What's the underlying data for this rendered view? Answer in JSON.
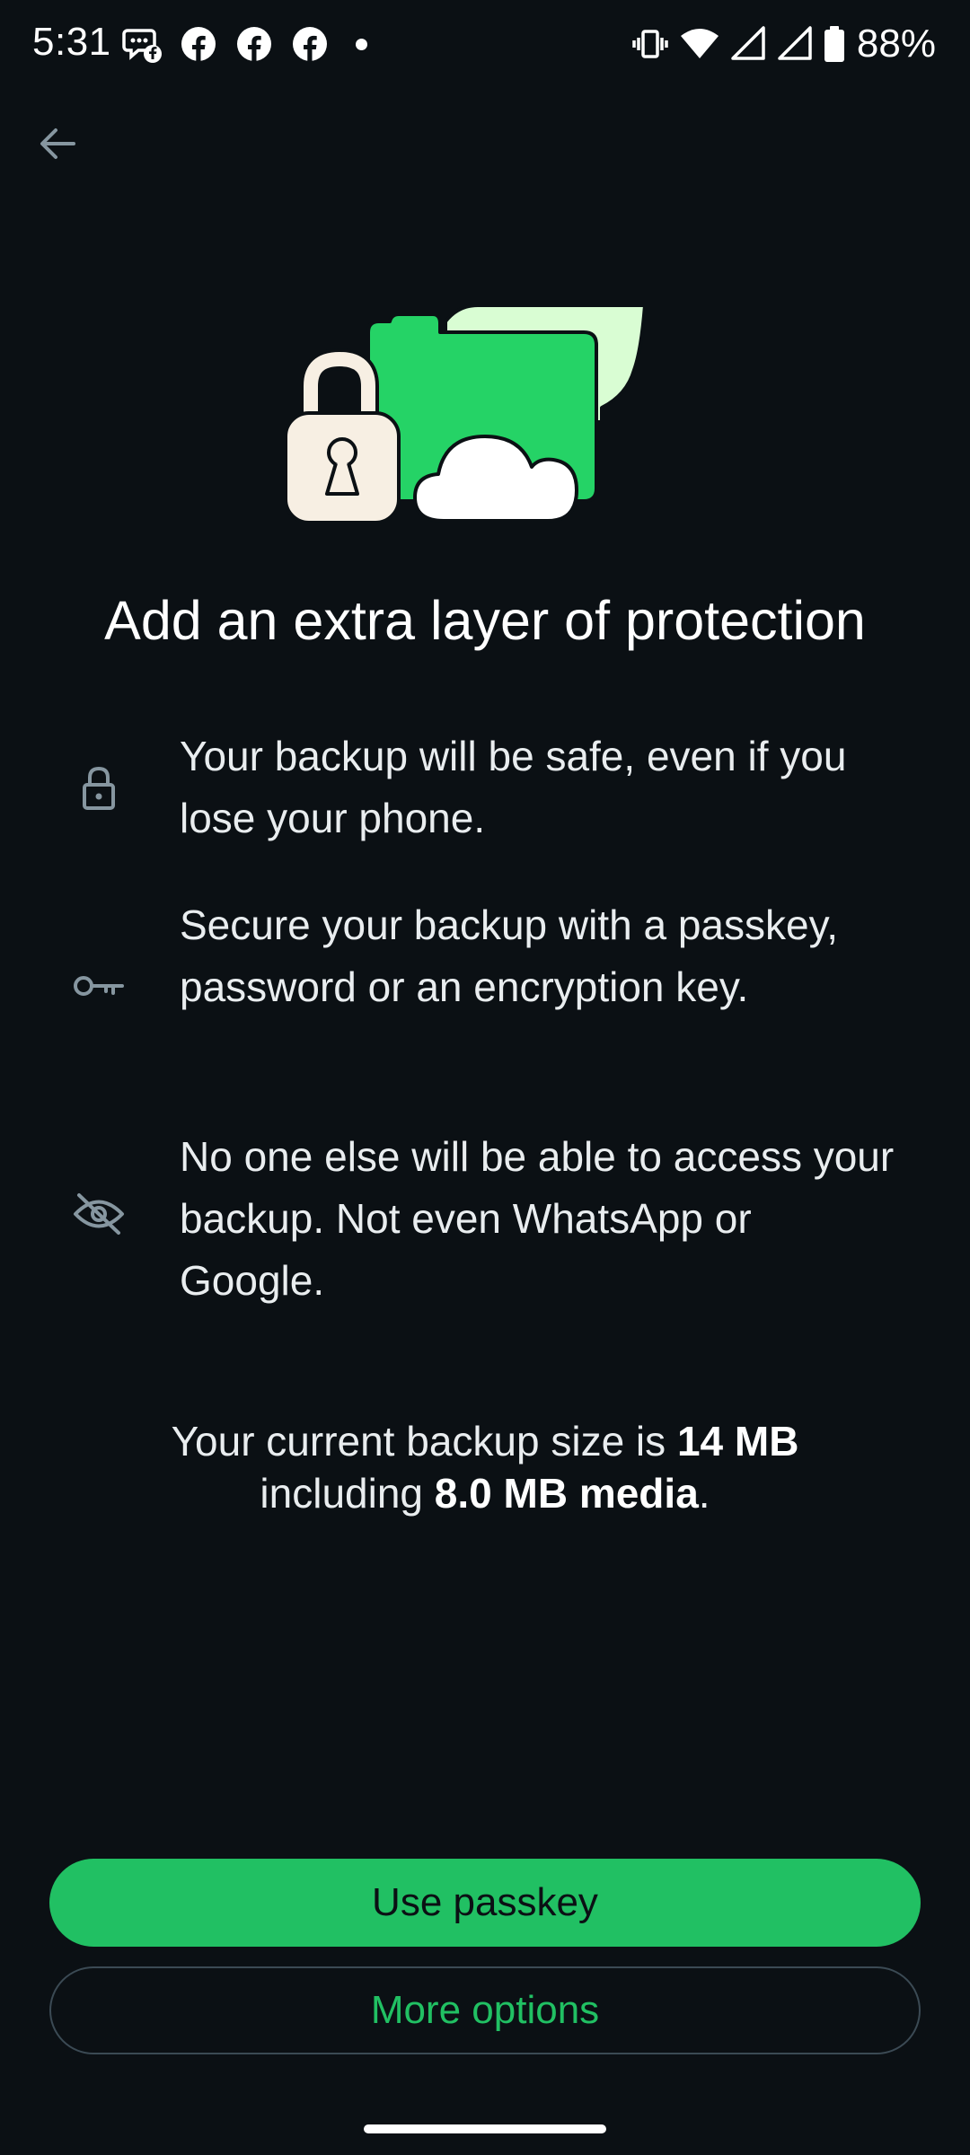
{
  "status_bar": {
    "time": "5:31",
    "battery_percent": "88%",
    "left_icons": [
      "messenger-icon",
      "facebook-icon",
      "facebook-icon",
      "facebook-icon",
      "notification-dot"
    ],
    "right_icons": [
      "vibrate-icon",
      "wifi-icon",
      "signal-icon",
      "signal-icon",
      "battery-icon"
    ]
  },
  "header": {
    "back_icon": "arrow-left-icon"
  },
  "hero": {
    "icon": "locked-folder-cloud-illustration",
    "colors": {
      "folder": "#25d366",
      "folder_back": "#d9fdd3",
      "lock_body": "#f7efe3",
      "cloud": "#ffffff",
      "outline": "#0b1014"
    }
  },
  "main": {
    "title": "Add an extra layer of protection",
    "features": [
      {
        "icon": "lock-icon",
        "text": "Your backup will be safe, even if you lose your phone."
      },
      {
        "icon": "key-icon",
        "text": "Secure your backup with a passkey, password or an encryption key."
      },
      {
        "icon": "eye-off-icon",
        "text": "No one else will be able to access your backup. Not even WhatsApp or Google."
      }
    ],
    "backup_size": {
      "prefix": "Your current backup size is",
      "size": "14 MB",
      "middle": "including",
      "media": "8.0 MB media",
      "suffix": "."
    }
  },
  "actions": {
    "primary_label": "Use passkey",
    "secondary_label": "More options"
  },
  "colors": {
    "background": "#0b1014",
    "accent": "#21c063",
    "text": "#e9edef",
    "icon_muted": "#8696a0",
    "outline_button_border": "#3b4a54"
  }
}
